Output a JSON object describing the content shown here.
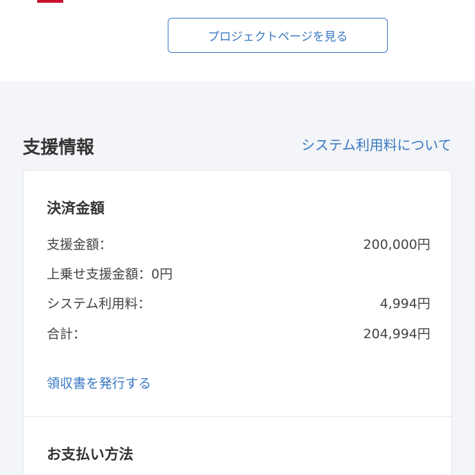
{
  "header": {
    "project_page_button": "プロジェクトページを見る"
  },
  "support_info": {
    "title": "支援情報",
    "fee_link": "システム利用料について",
    "payment_amount": {
      "title": "決済金額",
      "rows": [
        {
          "label": "支援金額：",
          "amount": "200,000円"
        },
        {
          "label": "上乗せ支援金額：0円",
          "amount": ""
        },
        {
          "label": "システム利用料：",
          "amount": "4,994円"
        },
        {
          "label": "合計：",
          "amount": "204,994円"
        }
      ],
      "receipt_link": "領収書を発行する"
    },
    "payment_method": {
      "title": "お支払い方法"
    }
  },
  "colors": {
    "accent": "#3a78c2",
    "background": "#f3f5f8",
    "card": "#ffffff"
  }
}
